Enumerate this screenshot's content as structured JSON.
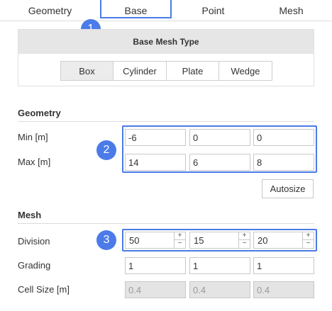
{
  "tabs": [
    {
      "label": "Geometry",
      "active": false
    },
    {
      "label": "Base",
      "active": true
    },
    {
      "label": "Point",
      "active": false
    },
    {
      "label": "Mesh",
      "active": false
    }
  ],
  "badges": [
    "1",
    "2",
    "3"
  ],
  "base_mesh_type": {
    "title": "Base Mesh Type",
    "options": [
      "Box",
      "Cylinder",
      "Plate",
      "Wedge"
    ],
    "selected": "Box"
  },
  "geometry": {
    "title": "Geometry",
    "min_label": "Min [m]",
    "min": [
      "-6",
      "0",
      "0"
    ],
    "max_label": "Max [m]",
    "max": [
      "14",
      "6",
      "8"
    ],
    "autosize_label": "Autosize"
  },
  "mesh": {
    "title": "Mesh",
    "division_label": "Division",
    "division": [
      "50",
      "15",
      "20"
    ],
    "grading_label": "Grading",
    "grading": [
      "1",
      "1",
      "1"
    ],
    "cell_size_label": "Cell Size [m]",
    "cell_size": [
      "0.4",
      "0.4",
      "0.4"
    ]
  },
  "stepper": {
    "plus": "+",
    "minus": "−"
  },
  "colors": {
    "accent": "#4a7be8",
    "header_bg": "#e6e6e6",
    "disabled_bg": "#e4e4e4"
  }
}
